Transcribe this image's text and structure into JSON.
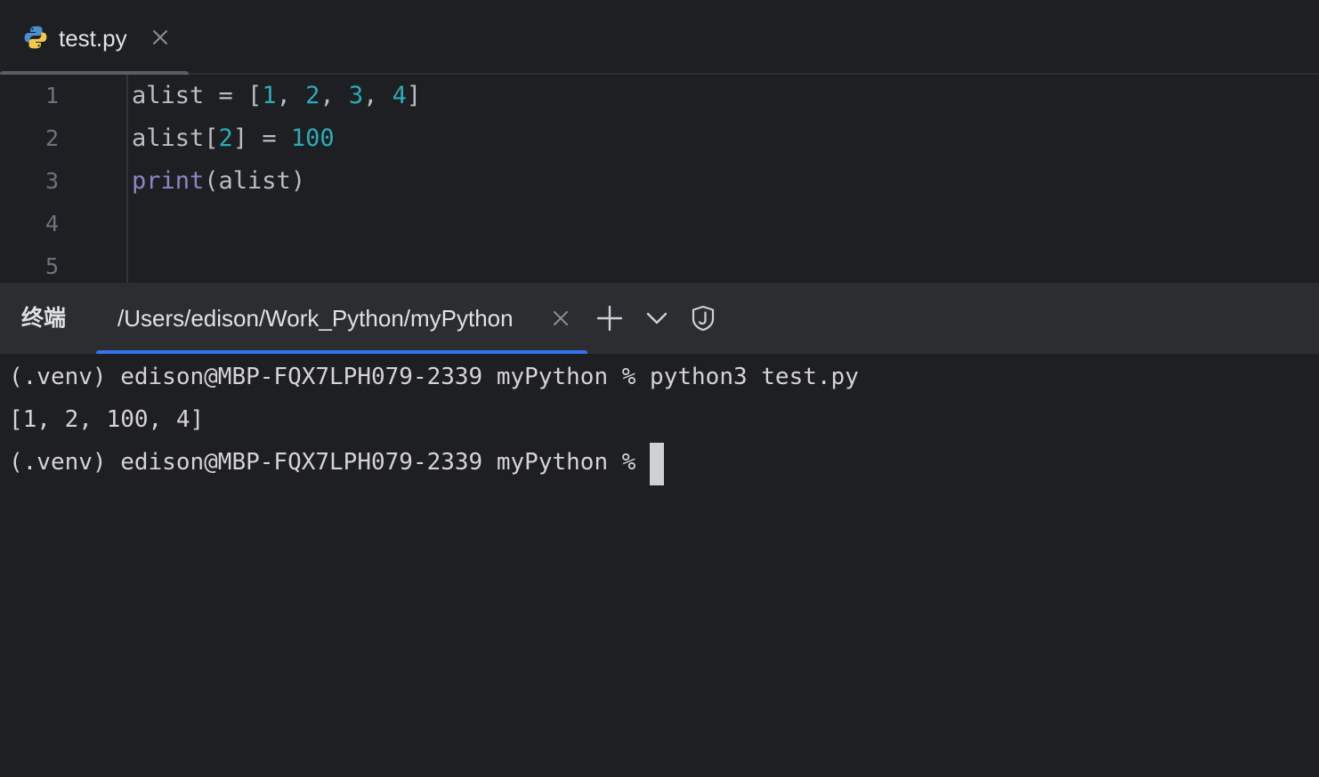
{
  "editor": {
    "tab": {
      "icon": "python-file-icon",
      "label": "test.py"
    },
    "lines": [
      {
        "number": "1",
        "tokens": [
          {
            "text": "alist = [",
            "kind": "plain"
          },
          {
            "text": "1",
            "kind": "num"
          },
          {
            "text": ", ",
            "kind": "plain"
          },
          {
            "text": "2",
            "kind": "num"
          },
          {
            "text": ", ",
            "kind": "plain"
          },
          {
            "text": "3",
            "kind": "num"
          },
          {
            "text": ", ",
            "kind": "plain"
          },
          {
            "text": "4",
            "kind": "num"
          },
          {
            "text": "]",
            "kind": "plain"
          }
        ]
      },
      {
        "number": "2",
        "tokens": [
          {
            "text": "alist[",
            "kind": "plain"
          },
          {
            "text": "2",
            "kind": "num"
          },
          {
            "text": "] = ",
            "kind": "plain"
          },
          {
            "text": "100",
            "kind": "num"
          }
        ]
      },
      {
        "number": "3",
        "tokens": [
          {
            "text": "print",
            "kind": "builtin"
          },
          {
            "text": "(alist)",
            "kind": "plain"
          }
        ]
      },
      {
        "number": "4",
        "tokens": []
      },
      {
        "number": "5",
        "tokens": []
      }
    ]
  },
  "terminal": {
    "title": "终端",
    "tab_label": "/Users/edison/Work_Python/myPython",
    "output": [
      "(.venv) edison@MBP-FQX7LPH079-2339 myPython % python3 test.py",
      "[1, 2, 100, 4]"
    ],
    "prompt": "(.venv) edison@MBP-FQX7LPH079-2339 myPython % "
  },
  "colors": {
    "background": "#1e1f22",
    "panel": "#2b2d30",
    "accent": "#3574f0",
    "number": "#2aacb8",
    "builtin": "#8888c6"
  }
}
